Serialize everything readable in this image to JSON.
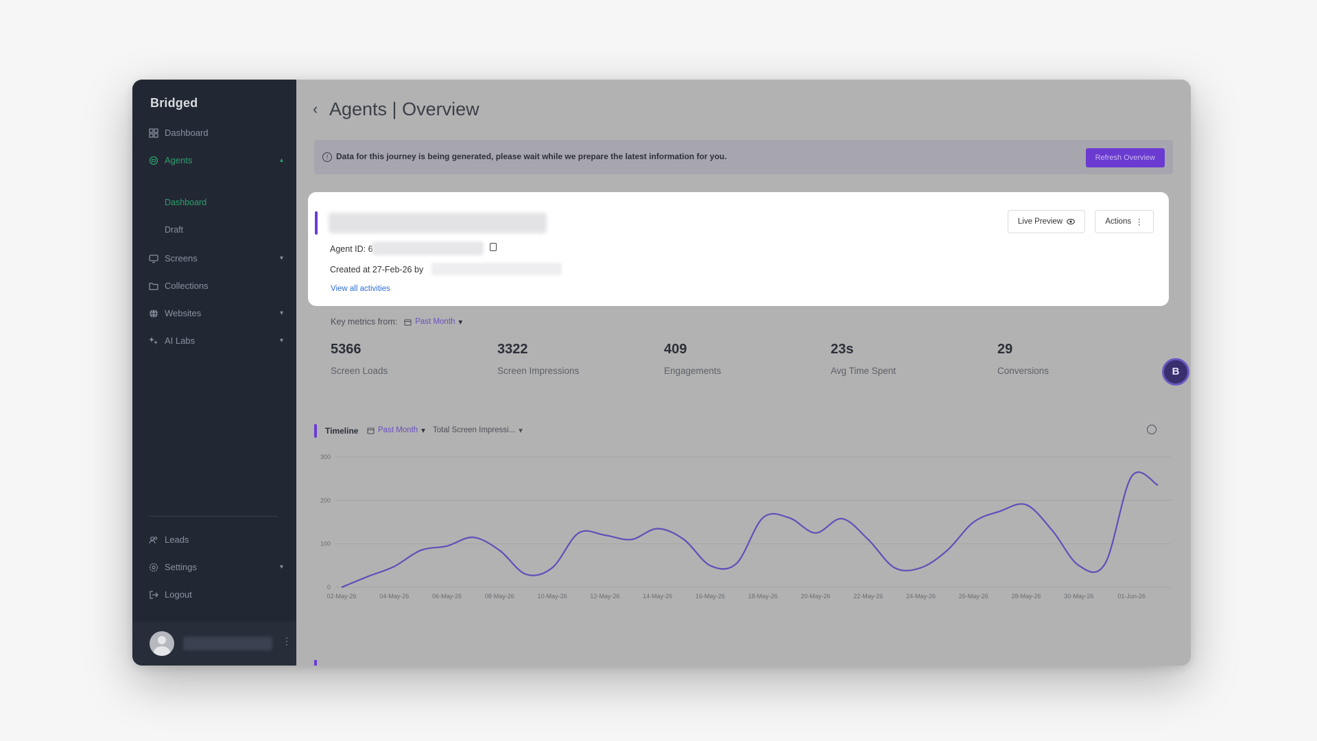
{
  "app": {
    "logo": "Bridged"
  },
  "sidebar": {
    "items": [
      {
        "label": "Dashboard",
        "icon": "grid-icon"
      },
      {
        "label": "Agents",
        "icon": "agent-icon",
        "expanded": true
      },
      {
        "label": "Screens",
        "icon": "screen-icon"
      },
      {
        "label": "Collections",
        "icon": "folder-icon"
      },
      {
        "label": "Websites",
        "icon": "globe-icon"
      },
      {
        "label": "AI Labs",
        "icon": "sparkle-icon"
      }
    ],
    "agents_sub": [
      {
        "label": "Dashboard",
        "active": true
      },
      {
        "label": "Draft"
      }
    ],
    "bottom": [
      {
        "label": "Leads",
        "icon": "users-icon"
      },
      {
        "label": "Settings",
        "icon": "gear-icon"
      },
      {
        "label": "Logout",
        "icon": "logout-icon"
      }
    ]
  },
  "header": {
    "title": "Agents | Overview"
  },
  "banner": {
    "text": "Data for this journey is being generated, please wait while we prepare the latest information for you.",
    "button": "Refresh Overview"
  },
  "agent_card": {
    "agent_id_label": "Agent ID: 6",
    "created_label": "Created at 27-Feb-26 by",
    "view_all": "View all activities",
    "live_preview": "Live Preview",
    "actions": "Actions"
  },
  "metrics": {
    "label": "Key metrics from:",
    "period": "Past Month",
    "items": [
      {
        "value": "5366",
        "label": "Screen Loads"
      },
      {
        "value": "3322",
        "label": "Screen Impressions"
      },
      {
        "value": "409",
        "label": "Engagements"
      },
      {
        "value": "23s",
        "label": "Avg Time Spent"
      },
      {
        "value": "29",
        "label": "Conversions"
      }
    ]
  },
  "timeline": {
    "title": "Timeline",
    "period": "Past Month",
    "metric": "Total Screen Impressi..."
  },
  "colors": {
    "accent": "#6a3bd4",
    "sidebar_bg": "#222833",
    "active_green": "#2e9e6e",
    "line": "#5f4fb8"
  },
  "chart_data": {
    "type": "line",
    "ylim": [
      0,
      300
    ],
    "yticks": [
      0,
      100,
      200,
      300
    ],
    "xticks": [
      "02-May-26",
      "04-May-26",
      "06-May-26",
      "08-May-26",
      "10-May-26",
      "12-May-26",
      "14-May-26",
      "16-May-26",
      "18-May-26",
      "20-May-26",
      "22-May-26",
      "24-May-26",
      "26-May-26",
      "28-May-26",
      "30-May-26",
      "01-Jun-26"
    ],
    "series": [
      {
        "x": [
          "02-May-26",
          "03-May-26",
          "04-May-26",
          "05-May-26",
          "06-May-26",
          "07-May-26",
          "08-May-26",
          "09-May-26",
          "10-May-26",
          "11-May-26",
          "12-May-26",
          "13-May-26",
          "14-May-26",
          "15-May-26",
          "16-May-26",
          "17-May-26",
          "18-May-26",
          "19-May-26",
          "20-May-26",
          "21-May-26",
          "22-May-26",
          "23-May-26",
          "24-May-26",
          "25-May-26",
          "26-May-26",
          "27-May-26",
          "28-May-26",
          "29-May-26",
          "30-May-26",
          "31-May-26",
          "01-Jun-26",
          "02-Jun-26"
        ],
        "values": [
          0,
          25,
          48,
          85,
          95,
          115,
          85,
          30,
          45,
          125,
          120,
          110,
          135,
          110,
          50,
          55,
          160,
          160,
          125,
          158,
          110,
          45,
          45,
          85,
          150,
          175,
          190,
          130,
          50,
          55,
          255,
          235
        ]
      }
    ]
  }
}
